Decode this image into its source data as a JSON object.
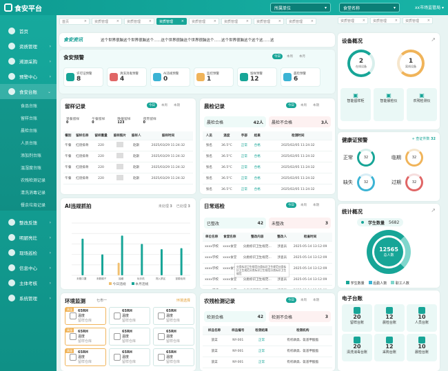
{
  "app": {
    "title": "食安平台",
    "unit_label": "所属单位",
    "shop_label": "食堂名称",
    "user_label": "xx市场监管局"
  },
  "menu": [
    {
      "label": "首页"
    },
    {
      "label": "资质管理"
    },
    {
      "label": "溯源采购"
    },
    {
      "label": "预警中心"
    },
    {
      "label": "食安台账"
    },
    {
      "label": "整改反馈"
    },
    {
      "label": "明厨亮灶"
    },
    {
      "label": "现场巡检"
    },
    {
      "label": "信息中心"
    },
    {
      "label": "主体考核"
    },
    {
      "label": "系统管理"
    }
  ],
  "submenu": [
    "食品台账",
    "留样台账",
    "晨检台账",
    "人员台账",
    "添加剂台账",
    "温湿度台账",
    "农残检测记录",
    "清洗消毒记录",
    "餐余垃圾记录"
  ],
  "tabs": [
    "首页",
    "资质管理",
    "资质管理",
    "资质管理",
    "资质管理",
    "资质管理",
    "资质管理",
    "资质管理",
    "资质管理",
    "资质管理",
    "资质管理",
    "资质管理"
  ],
  "notice": {
    "label": "食安资讯",
    "text": "这个世界很脑这个世界很脑这个......这个世界很脑这个世界很脑这个......这个世界很脑这个这个这......这"
  },
  "alerts": {
    "title": "食安预警",
    "periods": [
      "今日",
      "本周",
      "本月"
    ],
    "items": [
      {
        "label": "许可证预警",
        "value": "8"
      },
      {
        "label": "清洗消毒预警",
        "value": "4"
      },
      {
        "label": "AI违规预警",
        "value": "0"
      },
      {
        "label": "监控预警",
        "value": "1"
      },
      {
        "label": "留样预警",
        "value": "12"
      },
      {
        "label": "晨检预警",
        "value": "6"
      }
    ]
  },
  "sample": {
    "title": "留样记录",
    "periods": [
      "今日",
      "本周",
      "本期"
    ],
    "stats": [
      {
        "label": "早餐留样",
        "value": "0"
      },
      {
        "label": "午餐留样",
        "value": "0"
      },
      {
        "label": "晚餐留样",
        "value": "123"
      },
      {
        "label": "夜宵留样",
        "value": "0"
      }
    ],
    "headers": [
      "餐别",
      "留样名称",
      "留样重量",
      "留样照片",
      "留样人",
      "留样时间"
    ],
    "rows": [
      [
        "午餐",
        "红烧排骨",
        "220",
        "",
        "赵斯",
        "2025/03/29 11:24:32"
      ],
      [
        "午餐",
        "红烧排骨",
        "220",
        "",
        "赵斯",
        "2025/03/29 11:24:32"
      ],
      [
        "午餐",
        "红烧排骨",
        "220",
        "",
        "赵斯",
        "2025/03/29 11:24:32"
      ],
      [
        "午餐",
        "红烧排骨",
        "220",
        "",
        "赵斯",
        "2025/03/29 11:24:32"
      ]
    ]
  },
  "morning": {
    "title": "晨检记录",
    "periods": [
      "今日",
      "本周",
      "本期"
    ],
    "ok_label": "晨检合格",
    "ok_value": "42人",
    "bad_label": "晨检不合格",
    "bad_value": "3人",
    "headers": [
      "人员",
      "温度",
      "手部",
      "结果",
      "检测时间"
    ],
    "rows": [
      [
        "张名",
        "36.5°C",
        "正常",
        "合格",
        "2025/02/05 11:24:32"
      ],
      [
        "张名",
        "36.5°C",
        "正常",
        "合格",
        "2025/02/05 11:24:32"
      ],
      [
        "张名",
        "36.5°C",
        "正常",
        "合格",
        "2025/02/05 11:24:32"
      ],
      [
        "张名",
        "36.5°C",
        "正常",
        "合格",
        "2025/02/05 11:24:32"
      ],
      [
        "张名",
        "36.5°C",
        "正常",
        "合格",
        "2025/02/05 11:24:32"
      ]
    ]
  },
  "device": {
    "title": "设备概况",
    "items": [
      {
        "label": "在线设备",
        "value": "2"
      },
      {
        "label": "离线设备",
        "value": "1"
      }
    ],
    "types": [
      "智能留样柜",
      "智能晨检仪",
      "农残检测仪"
    ]
  },
  "health": {
    "title": "健康证预警",
    "link": "+ 查证件数",
    "link_value": "32",
    "items": [
      {
        "label": "正常",
        "value": "32"
      },
      {
        "label": "临期",
        "value": "32"
      },
      {
        "label": "缺失",
        "value": "32"
      },
      {
        "label": "过期",
        "value": "32"
      }
    ]
  },
  "ai": {
    "title": "AI违规抓拍",
    "legend_today": "今日违规",
    "legend_month": "本月违规",
    "stat1_label": "未处理",
    "stat1_value": "3",
    "stat2_label": "已处理",
    "stat2_value": "3",
    "tooltip_title": "本月违规",
    "tooltip_a": "今日违规",
    "tooltip_b": "本月违规"
  },
  "chart_data": {
    "type": "bar",
    "categories": [
      "未戴口罩",
      "未戴帽子",
      "抽烟",
      "玩手机",
      "闯入禁区",
      "鼠患检测"
    ],
    "series": [
      {
        "name": "今日违规",
        "values": [
          0,
          0,
          12,
          0,
          0,
          0
        ]
      },
      {
        "name": "本月违规",
        "values": [
          35,
          20,
          38,
          30,
          25,
          26
        ]
      }
    ],
    "ylim": [
      0,
      50
    ]
  },
  "patrol": {
    "title": "日常巡检",
    "periods": [
      "今日",
      "本周",
      "本期"
    ],
    "ok_label": "已整改",
    "ok_value": "42",
    "bad_label": "未整改",
    "bad_value": "3",
    "headers": [
      "单位名称",
      "食堂名称",
      "整改内容",
      "整改人",
      "检查时间"
    ],
    "rows": [
      [
        "xxxx学校",
        "xxxx食堂",
        "分类标识卫生规范...",
        "涉查员",
        "2025-05-14 13:12:09"
      ],
      [
        "xxxx学校",
        "xxxx食堂",
        "分类标识卫生规范...",
        "涉查员",
        "2025-05-14 13:12:09"
      ],
      [
        "xxxx学校",
        "xxxx食堂",
        "分类标识卫生规范...",
        "涉查员",
        "2025-05-14 13:12:09"
      ],
      [
        "xxxx学校",
        "xxxx食堂",
        "分类标识卫生规范...",
        "涉查员",
        "2025-05-14 13:12:09"
      ],
      [
        "xxxx学校",
        "xxxx食堂",
        "分类标识卫生规范...",
        "涉查员",
        "2025-05-14 13:12:09"
      ]
    ],
    "tooltip": "分类标识卫生规范分类标识卫生规范分类标识卫生规范分类标识卫生规范分类标识卫生规范"
  },
  "stats": {
    "title": "统计概况",
    "badge_label": "学生数量",
    "badge_value": "5682",
    "center_value": "12565",
    "center_label": "总人数",
    "legend": [
      "学生数量",
      "后勤人数",
      "职工人数"
    ]
  },
  "env": {
    "title": "环境监测",
    "period": "七市一",
    "link": "环境选择",
    "items": [
      {
        "tag": "高温",
        "value": "65RH",
        "name": "温度",
        "sub": "留样仓库"
      },
      {
        "tag": "",
        "value": "65RH",
        "name": "温度",
        "sub": "留样仓库"
      },
      {
        "tag": "",
        "value": "65RH",
        "name": "温度",
        "sub": "留样仓库"
      },
      {
        "tag": "高温",
        "value": "65RH",
        "name": "温度",
        "sub": "留样仓库"
      },
      {
        "tag": "",
        "value": "65RH",
        "name": "温度",
        "sub": "留样仓库"
      },
      {
        "tag": "",
        "value": "65RH",
        "name": "温度",
        "sub": "留样仓库"
      },
      {
        "tag": "高温",
        "value": "65RH",
        "name": "温度",
        "sub": "留样仓库"
      },
      {
        "tag": "",
        "value": "65RH",
        "name": "温度",
        "sub": "留样仓库"
      },
      {
        "tag": "",
        "value": "65RH",
        "name": "温度",
        "sub": "留样仓库"
      }
    ]
  },
  "pesticide": {
    "title": "农残检测记录",
    "periods": [
      "今日",
      "本周",
      "本期"
    ],
    "ok_label": "检测合格",
    "ok_value": "42",
    "bad_label": "检测不合格",
    "bad_value": "3",
    "headers": [
      "样品名称",
      "样品编号",
      "检测结果",
      "检测机构"
    ],
    "rows": [
      [
        "菠菜",
        "NY-001",
        "正常",
        "有机磷类、氨基甲酸酯"
      ],
      [
        "菠菜",
        "NY-001",
        "正常",
        "有机磷类、氨基甲酸酯"
      ],
      [
        "菠菜",
        "NY-001",
        "正常",
        "有机磷类、氨基甲酸酯"
      ]
    ]
  },
  "ledger": {
    "title": "电子台账",
    "items": [
      {
        "value": "20",
        "label": "留样台账"
      },
      {
        "value": "12",
        "label": "晨检台账"
      },
      {
        "value": "10",
        "label": "人员台账"
      },
      {
        "value": "20",
        "label": "清洗消毒台账"
      },
      {
        "value": "12",
        "label": "采购台账"
      },
      {
        "value": "10",
        "label": "晨检台账"
      }
    ]
  }
}
